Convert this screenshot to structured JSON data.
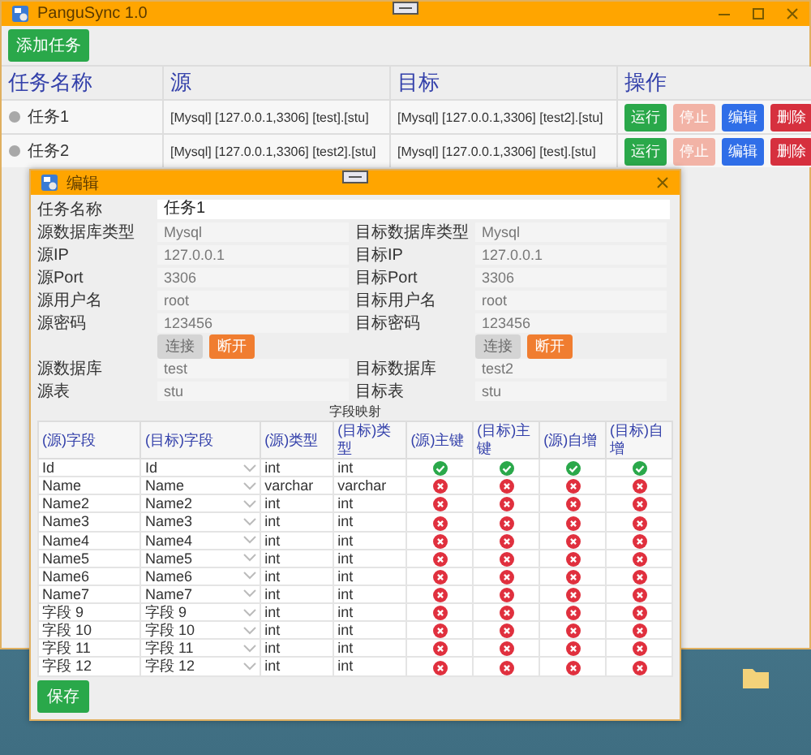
{
  "window": {
    "title": "PanguSync 1.0"
  },
  "toolbar": {
    "add_button": "添加任务"
  },
  "tasks_table": {
    "columns": [
      "任务名称",
      "源",
      "目标",
      "操作"
    ],
    "rows": [
      {
        "name": "任务1",
        "running": false,
        "source": "[Mysql]  [127.0.0.1,3306]  [test].[stu]",
        "target": "[Mysql]  [127.0.0.1,3306]  [test2].[stu]",
        "actions": [
          {
            "label": "运行",
            "kind": "run",
            "disabled": false
          },
          {
            "label": "停止",
            "kind": "stop",
            "disabled": true
          },
          {
            "label": "编辑",
            "kind": "edit",
            "disabled": false
          },
          {
            "label": "删除",
            "kind": "delete",
            "disabled": false
          }
        ]
      },
      {
        "name": "任务2",
        "running": false,
        "source": "[Mysql]  [127.0.0.1,3306]  [test2].[stu]",
        "target": "[Mysql]  [127.0.0.1,3306]  [test].[stu]",
        "actions": [
          {
            "label": "运行",
            "kind": "run",
            "disabled": false
          },
          {
            "label": "停止",
            "kind": "stop",
            "disabled": true
          },
          {
            "label": "编辑",
            "kind": "edit",
            "disabled": false
          },
          {
            "label": "删除",
            "kind": "delete",
            "disabled": false
          }
        ]
      }
    ]
  },
  "dialog": {
    "title": "编辑",
    "task_name": {
      "label": "任务名称",
      "value": "任务1"
    },
    "source": {
      "fields": [
        {
          "label": "源数据库类型",
          "value": "Mysql"
        },
        {
          "label": "源IP",
          "value": "127.0.0.1"
        },
        {
          "label": "源Port",
          "value": "3306"
        },
        {
          "label": "源用户名",
          "value": "root"
        },
        {
          "label": "源密码",
          "value": "123456"
        }
      ],
      "buttons": [
        {
          "label": "连接",
          "kind": "connect",
          "disabled": true
        },
        {
          "label": "断开",
          "kind": "disconnect",
          "disabled": false
        }
      ],
      "database": {
        "label": "源数据库",
        "value": "test"
      },
      "table": {
        "label": "源表",
        "value": "stu"
      }
    },
    "target": {
      "fields": [
        {
          "label": "目标数据库类型",
          "value": "Mysql"
        },
        {
          "label": "目标IP",
          "value": "127.0.0.1"
        },
        {
          "label": "目标Port",
          "value": "3306"
        },
        {
          "label": "目标用户名",
          "value": "root"
        },
        {
          "label": "目标密码",
          "value": "123456"
        }
      ],
      "buttons": [
        {
          "label": "连接",
          "kind": "connect",
          "disabled": true
        },
        {
          "label": "断开",
          "kind": "disconnect",
          "disabled": false
        }
      ],
      "database": {
        "label": "目标数据库",
        "value": "test2"
      },
      "table": {
        "label": "目标表",
        "value": "stu"
      }
    },
    "mapping": {
      "caption": "字段映射",
      "columns": [
        "(源)字段",
        "(目标)字段",
        "(源)类型",
        "(目标)类型",
        "(源)主键",
        "(目标)主键",
        "(源)自增",
        "(目标)自增"
      ],
      "rows": [
        {
          "source_field": "Id",
          "target_field": "Id",
          "source_type": "int",
          "target_type": "int",
          "flags": [
            true,
            true,
            true,
            true
          ]
        },
        {
          "source_field": "Name",
          "target_field": "Name",
          "source_type": "varchar",
          "target_type": "varchar",
          "flags": [
            false,
            false,
            false,
            false
          ]
        },
        {
          "source_field": "Name2",
          "target_field": "Name2",
          "source_type": "int",
          "target_type": "int",
          "flags": [
            false,
            false,
            false,
            false
          ]
        },
        {
          "source_field": "Name3",
          "target_field": "Name3",
          "source_type": "int",
          "target_type": "int",
          "flags": [
            false,
            false,
            false,
            false
          ]
        },
        {
          "source_field": "Name4",
          "target_field": "Name4",
          "source_type": "int",
          "target_type": "int",
          "flags": [
            false,
            false,
            false,
            false
          ]
        },
        {
          "source_field": "Name5",
          "target_field": "Name5",
          "source_type": "int",
          "target_type": "int",
          "flags": [
            false,
            false,
            false,
            false
          ]
        },
        {
          "source_field": "Name6",
          "target_field": "Name6",
          "source_type": "int",
          "target_type": "int",
          "flags": [
            false,
            false,
            false,
            false
          ]
        },
        {
          "source_field": "Name7",
          "target_field": "Name7",
          "source_type": "int",
          "target_type": "int",
          "flags": [
            false,
            false,
            false,
            false
          ]
        },
        {
          "source_field": "字段 9",
          "target_field": "字段 9",
          "source_type": "int",
          "target_type": "int",
          "flags": [
            false,
            false,
            false,
            false
          ]
        },
        {
          "source_field": "字段 10",
          "target_field": "字段 10",
          "source_type": "int",
          "target_type": "int",
          "flags": [
            false,
            false,
            false,
            false
          ]
        },
        {
          "source_field": "字段 11",
          "target_field": "字段 11",
          "source_type": "int",
          "target_type": "int",
          "flags": [
            false,
            false,
            false,
            false
          ]
        },
        {
          "source_field": "字段 12",
          "target_field": "字段 12",
          "source_type": "int",
          "target_type": "int",
          "flags": [
            false,
            false,
            false,
            false
          ]
        }
      ]
    },
    "save_button": "保存"
  }
}
